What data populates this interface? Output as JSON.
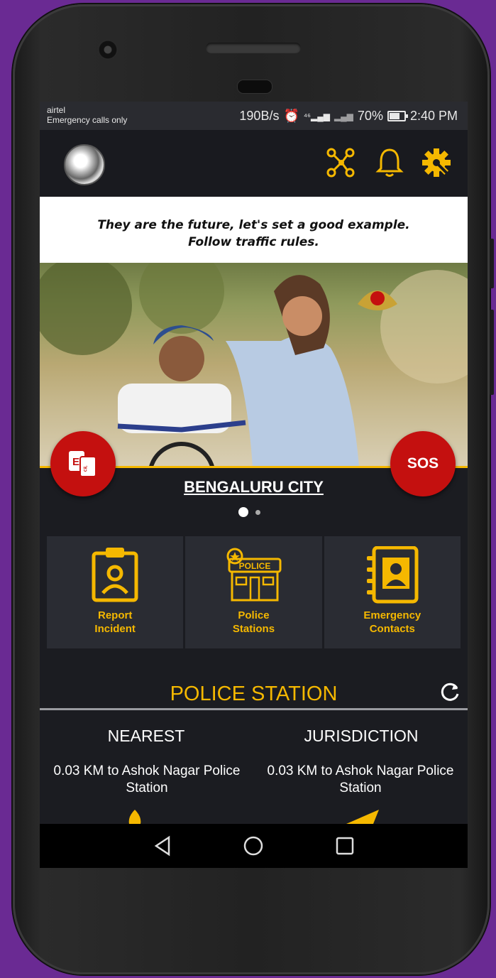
{
  "status_bar": {
    "carrier": "airtel",
    "carrier_note": "Emergency calls only",
    "net_speed": "190B/s",
    "network_label": "⁴⁶",
    "battery": "70%",
    "time": "2:40 PM"
  },
  "app_bar": {
    "icons": [
      "avatar",
      "network-icon",
      "bell-icon",
      "settings-icon"
    ]
  },
  "banner": {
    "line1": "They are the future, let's set a good example.",
    "line2": "Follow traffic rules."
  },
  "language_button": {
    "label_a": "E",
    "label_b": "ಕ"
  },
  "sos_button": {
    "label": "SOS"
  },
  "city": "BENGALURU CITY",
  "carousel": {
    "pages": 2,
    "active": 1
  },
  "quick_actions": [
    {
      "line1": "Report",
      "line2": "Incident",
      "icon": "clipboard-person-icon"
    },
    {
      "line1": "Police",
      "line2": "Stations",
      "icon": "police-building-icon",
      "badge": "POLICE"
    },
    {
      "line1": "Emergency",
      "line2": "Contacts",
      "icon": "contact-book-icon"
    }
  ],
  "police_station": {
    "title": "POLICE STATION",
    "nearest": {
      "heading": "NEAREST",
      "text": "0.03 KM to Ashok Nagar Police Station"
    },
    "jurisdiction": {
      "heading": "JURISDICTION",
      "text": "0.03 KM to Ashok Nagar Police Station"
    }
  },
  "colors": {
    "accent": "#f5b800",
    "danger": "#c4100f",
    "background": "#1b1c21"
  }
}
